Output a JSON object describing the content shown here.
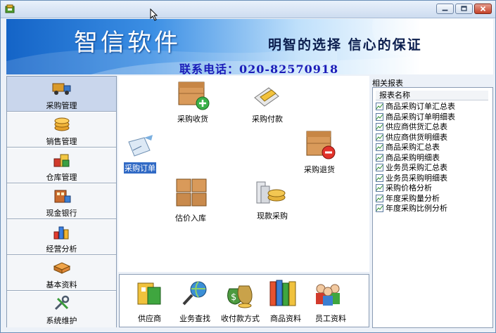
{
  "banner": {
    "brand": "智信软件",
    "slogan": "明智的选择 信心的保证",
    "hotline": "联系电话：020-82570918",
    "colors": {
      "deep": "#1464c7",
      "light": "#bfe0fb"
    }
  },
  "sidebar": {
    "items": [
      {
        "label": "采购管理",
        "icon": "truck-icon",
        "active": true
      },
      {
        "label": "销售管理",
        "icon": "coin-stack-icon"
      },
      {
        "label": "仓库管理",
        "icon": "goods-icon"
      },
      {
        "label": "现金银行",
        "icon": "bank-icon"
      },
      {
        "label": "经营分析",
        "icon": "chart-icon"
      },
      {
        "label": "基本资料",
        "icon": "book-icon"
      },
      {
        "label": "系统维护",
        "icon": "tools-icon"
      }
    ]
  },
  "workspace": {
    "receive": "采购收货",
    "pay": "采购付款",
    "order": "采购订单",
    "return": "采购退货",
    "estimate": "估价入库",
    "cash_purchase": "现款采购"
  },
  "bottom": {
    "supplier": "供应商",
    "business_search": "业务查找",
    "payment_method": "收付款方式",
    "product_info": "商品资料",
    "staff_info": "员工资料"
  },
  "reports": {
    "title": "相关报表",
    "column": "报表名称",
    "items": [
      "商品采购订单汇总表",
      "商品采购订单明细表",
      "供应商供货汇总表",
      "供应商供货明细表",
      "商品采购汇总表",
      "商品采购明细表",
      "业务员采购汇总表",
      "业务员采购明细表",
      "采购价格分析",
      "年度采购量分析",
      "年度采购比例分析"
    ]
  }
}
